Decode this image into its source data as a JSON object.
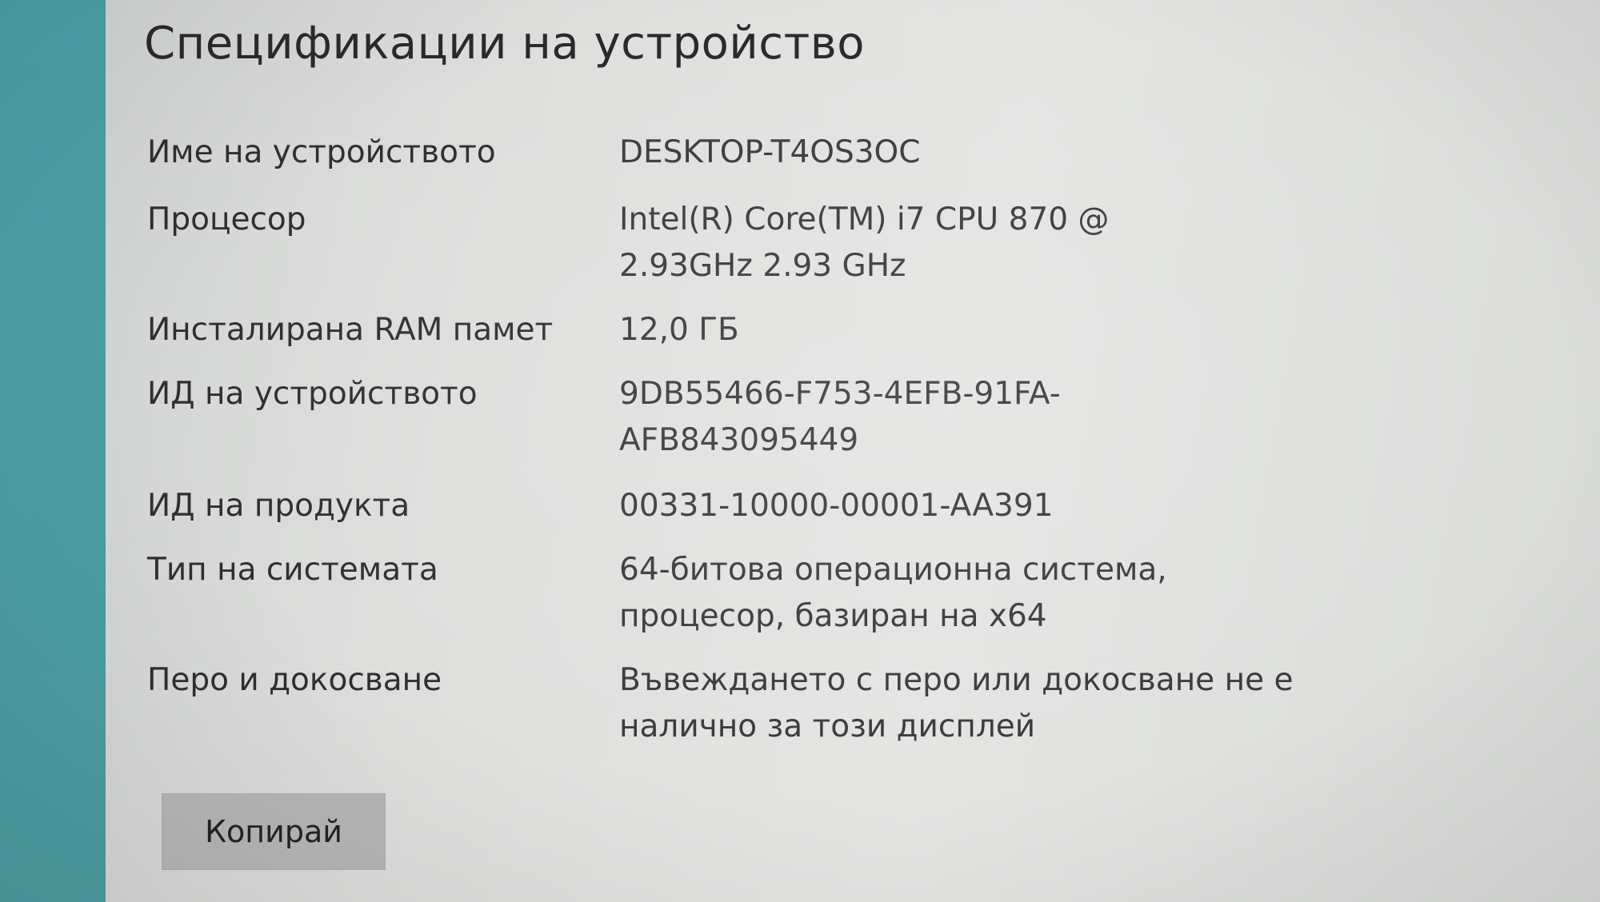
{
  "page_title": "Спецификации на устройство",
  "specs": [
    {
      "label": "Име на устройството",
      "value": "DESKTOP-T4OS3OC"
    },
    {
      "label": "Процесор",
      "value": "Intel(R) Core(TM) i7 CPU        870  @\n2.93GHz   2.93 GHz"
    },
    {
      "label": "Инсталирана RAM памет",
      "value": "12,0 ГБ"
    },
    {
      "label": "ИД на устройството",
      "value": "9DB55466-F753-4EFB-91FA-\nAFB843095449"
    },
    {
      "label": "ИД на продукта",
      "value": "00331-10000-00001-AA391"
    },
    {
      "label": "Тип на системата",
      "value": "64-битова операционна система,\nпроцесор, базиран на x64"
    },
    {
      "label": "Перо и докосване",
      "value": "Въвеждането с перо или докосване не е\nналично за този дисплей"
    }
  ],
  "copy_button_label": "Копирай",
  "colors": {
    "accent_strip": "#4aa1a6",
    "background": "#dedfdd",
    "button": "#b5b6b5"
  }
}
